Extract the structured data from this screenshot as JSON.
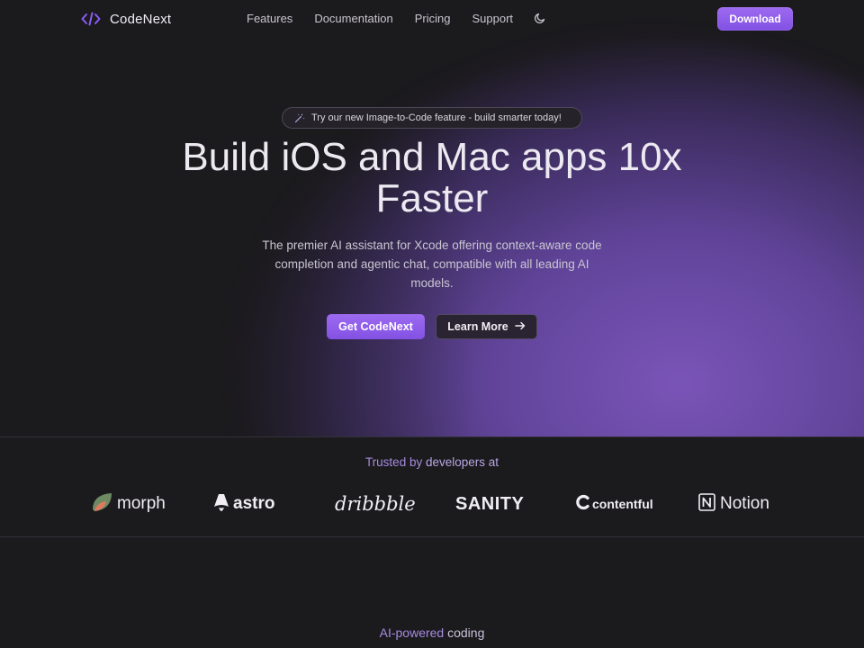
{
  "nav": {
    "brand": "CodeNext",
    "links": [
      "Features",
      "Documentation",
      "Pricing",
      "Support"
    ],
    "download_label": "Download"
  },
  "hero": {
    "announcement": "Try our new Image-to-Code feature - build smarter today!",
    "headline_line1": "Build iOS and Mac apps 10x",
    "headline_line2": "Faster",
    "subtitle": "The premier AI assistant for Xcode offering context-aware code completion and agentic chat, compatible with all leading AI models.",
    "primary_cta": "Get CodeNext",
    "secondary_cta": "Learn More"
  },
  "trusted": {
    "label_accent": "Trusted by",
    "label_plain": "developers at",
    "logos": [
      "morph",
      "astro",
      "dribbble",
      "SANITY",
      "contentful",
      "Notion"
    ]
  },
  "next_section": {
    "label_accent": "AI-powered",
    "label_plain": "coding"
  },
  "colors": {
    "background": "#1b1a1d",
    "accent": "#8b5cf6",
    "accent_text": "#a78be0"
  }
}
